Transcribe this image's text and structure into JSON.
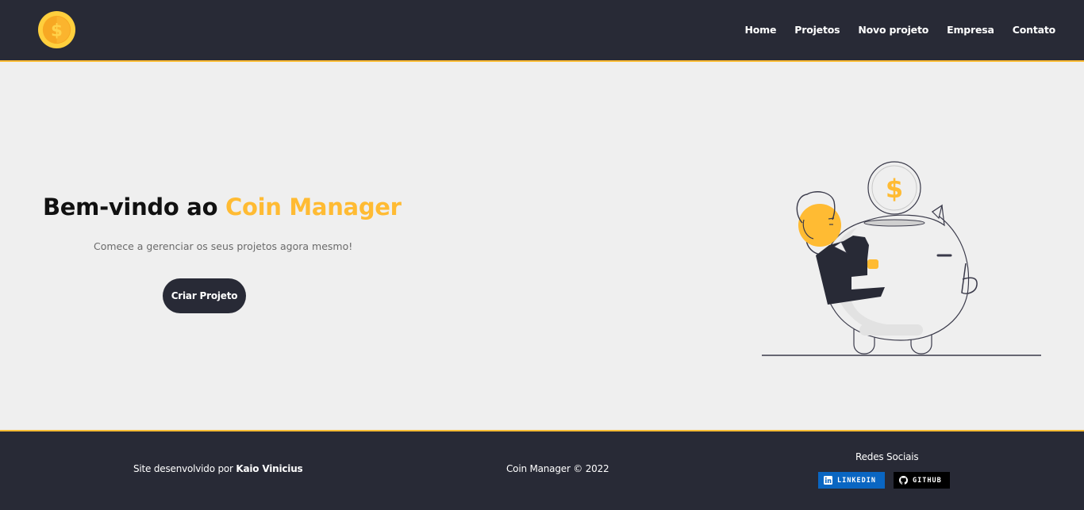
{
  "colors": {
    "primary_dark": "#282a36",
    "accent": "#ffbb33",
    "background": "#efefef",
    "linkedin": "#0a66c2",
    "github": "#000000"
  },
  "header": {
    "logo_icon": "dollar-coin-icon",
    "nav": [
      {
        "label": "Home"
      },
      {
        "label": "Projetos"
      },
      {
        "label": "Novo projeto"
      },
      {
        "label": "Empresa"
      },
      {
        "label": "Contato"
      }
    ]
  },
  "hero": {
    "title_prefix": "Bem-vindo ao ",
    "title_highlight": "Coin Manager",
    "subtitle": "Comece a gerenciar os seus projetos agora mesmo!",
    "cta_label": "Criar Projeto",
    "illustration": "piggy-bank-coin-illustration"
  },
  "footer": {
    "credit_prefix": "Site desenvolvido por ",
    "credit_author": "Kaio Vinicius",
    "copyright": "Coin Manager © 2022",
    "social_title": "Redes Sociais",
    "social": [
      {
        "label": "LINKEDIN",
        "icon": "linkedin-icon"
      },
      {
        "label": "GITHUB",
        "icon": "github-icon"
      }
    ]
  }
}
